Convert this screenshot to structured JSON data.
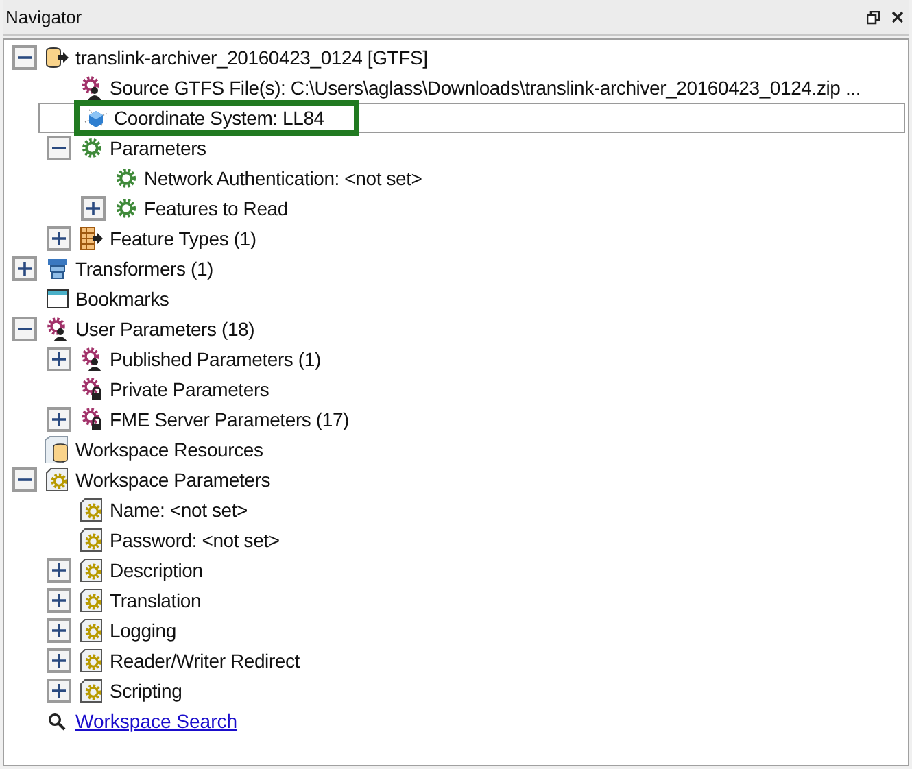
{
  "panel": {
    "title": "Navigator"
  },
  "tree": [
    {
      "label": "translink-archiver_20160423_0124 [GTFS]",
      "kind": "reader",
      "expanded": true,
      "selected": false,
      "children": [
        {
          "label": "Source GTFS File(s): C:\\Users\\aglass\\Downloads\\translink-archiver_20160423_0124.zip ...",
          "kind": "user-gear",
          "selected": false
        },
        {
          "label": "Coordinate System: LL84",
          "kind": "coordinate",
          "selected": true
        },
        {
          "label": "Parameters",
          "kind": "gear",
          "expanded": true,
          "selected": false,
          "children": [
            {
              "label": "Network Authentication: <not set>",
              "kind": "gear",
              "selected": false
            },
            {
              "label": "Features to Read",
              "kind": "gear",
              "expanded": false,
              "selected": false
            }
          ]
        },
        {
          "label": "Feature Types (1)",
          "kind": "feature-types",
          "expanded": false,
          "selected": false
        }
      ]
    },
    {
      "label": "Transformers (1)",
      "kind": "transformer",
      "expanded": false,
      "selected": false
    },
    {
      "label": "Bookmarks",
      "kind": "bookmark",
      "selected": false
    },
    {
      "label": "User Parameters (18)",
      "kind": "user-gear",
      "expanded": true,
      "selected": false,
      "children": [
        {
          "label": "Published Parameters (1)",
          "kind": "user-gear",
          "expanded": false,
          "selected": false
        },
        {
          "label": "Private Parameters",
          "kind": "lock-gear",
          "selected": false
        },
        {
          "label": "FME Server Parameters (17)",
          "kind": "lock-gear",
          "expanded": false,
          "selected": false
        }
      ]
    },
    {
      "label": "Workspace Resources",
      "kind": "resources",
      "selected": false
    },
    {
      "label": "Workspace Parameters",
      "kind": "doc-gear",
      "expanded": true,
      "selected": false,
      "children": [
        {
          "label": "Name: <not set>",
          "kind": "doc-gear",
          "selected": false
        },
        {
          "label": "Password: <not set>",
          "kind": "doc-gear",
          "selected": false
        },
        {
          "label": "Description",
          "kind": "doc-gear",
          "expanded": false,
          "selected": false
        },
        {
          "label": "Translation",
          "kind": "doc-gear",
          "expanded": false,
          "selected": false
        },
        {
          "label": "Logging",
          "kind": "doc-gear",
          "expanded": false,
          "selected": false
        },
        {
          "label": "Reader/Writer Redirect",
          "kind": "doc-gear",
          "expanded": false,
          "selected": false
        },
        {
          "label": "Scripting",
          "kind": "doc-gear",
          "expanded": false,
          "selected": false
        }
      ]
    }
  ],
  "search_link": {
    "label": "Workspace Search"
  }
}
